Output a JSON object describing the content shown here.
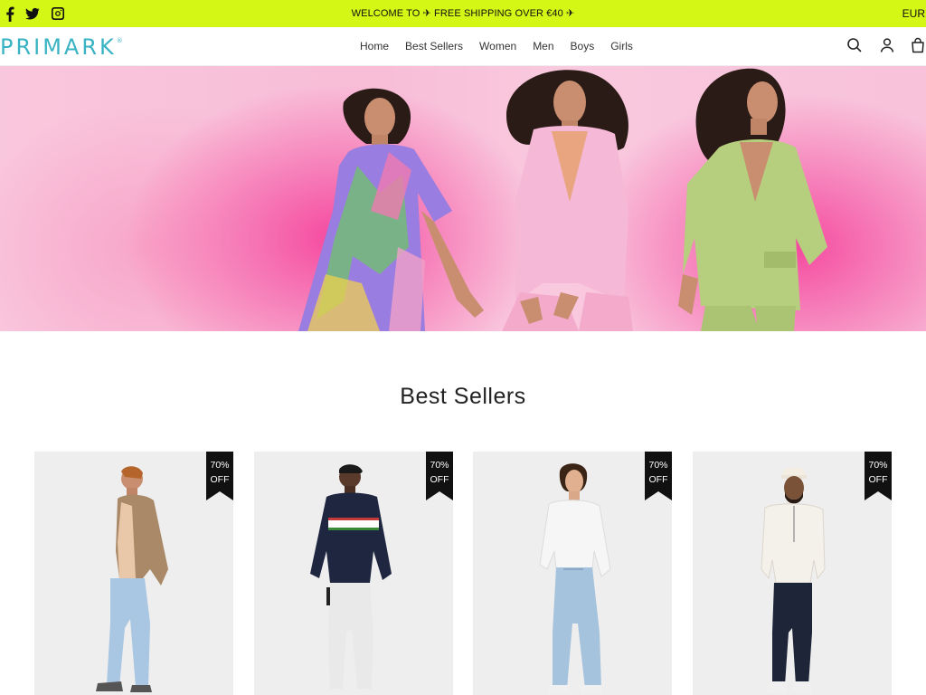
{
  "topbar": {
    "announcement": "WELCOME TO  ✈ FREE SHIPPING OVER €40 ✈",
    "currency": "EUR",
    "background": "#d4f716",
    "social_icons": [
      "facebook-icon",
      "twitter-icon",
      "instagram-icon"
    ]
  },
  "header": {
    "logo": "PRIMARK",
    "logo_mark": "®",
    "logo_color": "#39b3c4",
    "nav": [
      "Home",
      "Best Sellers",
      "Women",
      "Men",
      "Boys",
      "Girls"
    ],
    "icons": [
      "search-icon",
      "account-icon",
      "cart-icon"
    ]
  },
  "hero": {
    "image": "banner with three women in a floral dress, a pink suit and a green suit",
    "accent_color": "#f54aa0"
  },
  "best_sellers": {
    "title": "Best Sellers",
    "products": [
      {
        "badge_line1": "70%",
        "badge_line2": "OFF",
        "image": "man in tan jacket and light jeans"
      },
      {
        "badge_line1": "70%",
        "badge_line2": "OFF",
        "image": "man in navy striped sweatshirt and white joggers"
      },
      {
        "badge_line1": "70%",
        "badge_line2": "OFF",
        "image": "person in white sweater and light jeans"
      },
      {
        "badge_line1": "70%",
        "badge_line2": "OFF",
        "image": "man in cream half-zip and navy trousers"
      }
    ]
  }
}
